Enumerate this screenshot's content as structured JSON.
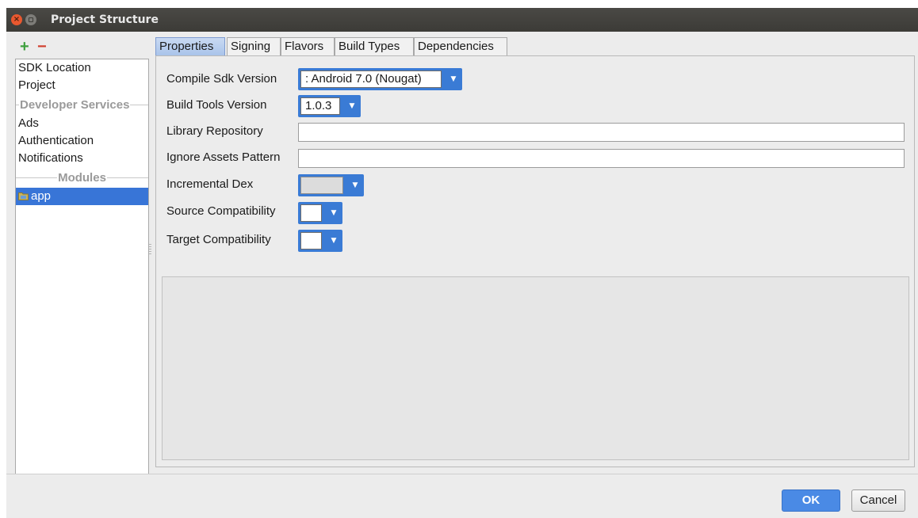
{
  "window": {
    "title": "Project Structure",
    "close_glyph": "×"
  },
  "toolbar": {
    "add_label": "+",
    "remove_label": "−"
  },
  "sidebar": {
    "items": [
      {
        "label": "SDK Location"
      },
      {
        "label": "Project"
      }
    ],
    "developer_services_header": "Developer Services",
    "service_items": [
      {
        "label": "Ads"
      },
      {
        "label": "Authentication"
      },
      {
        "label": "Notifications"
      }
    ],
    "modules_header": "Modules",
    "modules": [
      {
        "label": "app",
        "selected": true,
        "icon": "module-folder-icon"
      }
    ]
  },
  "tabs": [
    {
      "label": "Properties",
      "active": true
    },
    {
      "label": "Signing"
    },
    {
      "label": "Flavors"
    },
    {
      "label": "Build Types"
    },
    {
      "label": "Dependencies"
    }
  ],
  "form": {
    "compile_sdk": {
      "label": "Compile Sdk Version",
      "value": ": Android 7.0 (Nougat)"
    },
    "build_tools": {
      "label": "Build Tools Version",
      "value": "1.0.3"
    },
    "library_repository": {
      "label": "Library Repository",
      "value": ""
    },
    "ignore_assets": {
      "label": "Ignore Assets Pattern",
      "value": ""
    },
    "incremental_dex": {
      "label": "Incremental Dex",
      "value": ""
    },
    "source_compat": {
      "label": "Source Compatibility",
      "value": ""
    },
    "target_compat": {
      "label": "Target Compatibility",
      "value": ""
    }
  },
  "buttons": {
    "ok": "OK",
    "cancel": "Cancel"
  },
  "colors": {
    "accent": "#3a7bd5",
    "selection": "#3875d7",
    "add": "#3ea03e",
    "remove": "#d04030"
  }
}
